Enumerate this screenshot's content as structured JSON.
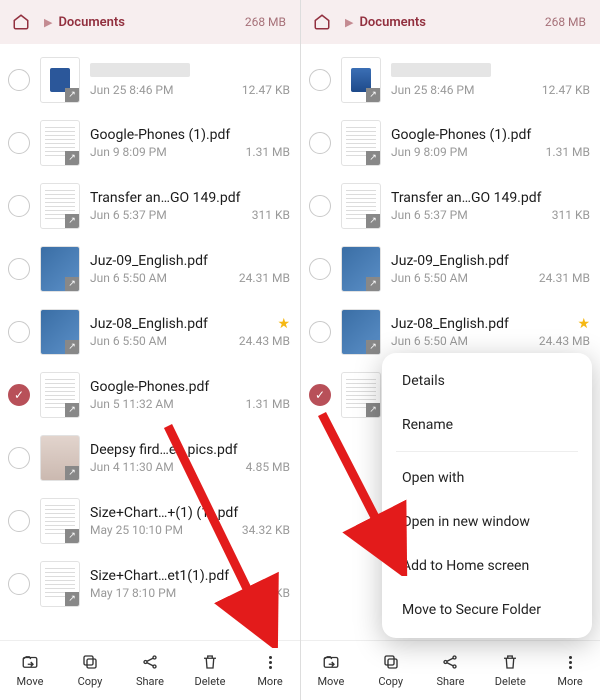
{
  "breadcrumb": {
    "label": "Documents",
    "total_size": "268 MB"
  },
  "files": [
    {
      "name_blurred": true,
      "date": "Jun 25 8:46 PM",
      "size": "12.47 KB",
      "kind": "word"
    },
    {
      "name": "Google-Phones (1).pdf",
      "date": "Jun 9 8:09 PM",
      "size": "1.31 MB",
      "kind": "doc"
    },
    {
      "name": "Transfer an…GO 149.pdf",
      "date": "Jun 6 5:37 PM",
      "size": "311 KB",
      "kind": "doc"
    },
    {
      "name": "Juz-09_English.pdf",
      "date": "Jun 6 5:50 AM",
      "size": "24.31 MB",
      "kind": "blue"
    },
    {
      "name": "Juz-08_English.pdf",
      "date": "Jun 6 5:50 AM",
      "size": "24.43 MB",
      "kind": "blue",
      "starred": true
    },
    {
      "name": "Google-Phones.pdf",
      "date": "Jun 5 11:32 AM",
      "size": "1.31 MB",
      "kind": "doc",
      "selected": true
    },
    {
      "name": "Deepsy fird…en pics.pdf",
      "date": "Jun 4 11:30 AM",
      "size": "4.85 MB",
      "kind": "photo"
    },
    {
      "name": "Size+Chart…+(1) (1).pdf",
      "date": "May 25 10:10 PM",
      "size": "34.32 KB",
      "kind": "doc"
    },
    {
      "name": "Size+Chart…et1(1).pdf",
      "date": "May 17 8:10 PM",
      "size": "34.32 KB",
      "kind": "doc"
    }
  ],
  "bottom": {
    "move": "Move",
    "copy": "Copy",
    "share": "Share",
    "delete": "Delete",
    "more": "More"
  },
  "menu": {
    "details": "Details",
    "rename": "Rename",
    "open_with": "Open with",
    "open_new_window": "Open in new window",
    "add_home": "Add to Home screen",
    "secure_folder": "Move to Secure Folder"
  }
}
